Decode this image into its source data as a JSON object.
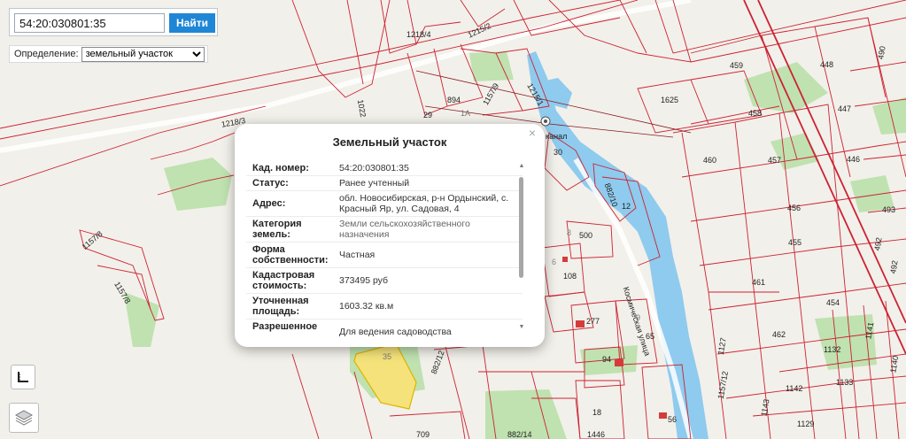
{
  "search": {
    "value": "54:20:030801:35",
    "button_label": "Найти"
  },
  "definition": {
    "label": "Определение:",
    "selected": "земельный участок"
  },
  "popup": {
    "title": "Земельный участок",
    "close_symbol": "×",
    "rows": [
      {
        "label": "Кад. номер:",
        "value": "54:20:030801:35"
      },
      {
        "label": "Статус:",
        "value": "Ранее учтенный"
      },
      {
        "label": "Адрес:",
        "value": "обл. Новосибирская, р-н Ордынский, с. Красный Яр, ул. Садовая, 4"
      },
      {
        "label": "Категория земель:",
        "value": "Земли сельскохозяйственного назначения"
      },
      {
        "label": "Форма собственности:",
        "value": "Частная"
      },
      {
        "label": "Кадастровая стоимость:",
        "value": "373495 руб"
      },
      {
        "label": "Уточненная площадь:",
        "value": "1603.32 кв.м"
      },
      {
        "label": "Разрешенное",
        "value": "Для ведения садоводства"
      }
    ]
  },
  "map": {
    "parcel_labels": [
      "1218/4",
      "1215/2",
      "1218/3",
      "1022",
      "1157/9",
      "1215/1",
      "894",
      "29",
      "1А",
      "1625",
      "459",
      "448",
      "490",
      "458",
      "447",
      "460",
      "457",
      "446",
      "456",
      "493",
      "455",
      "492",
      "492",
      "461",
      "454",
      "462",
      "1141",
      "1132",
      "1140",
      "1133",
      "1142",
      "1143",
      "1129",
      "30",
      "882/10",
      "12",
      "8",
      "500",
      "6",
      "108",
      "1157/8",
      "1157/8",
      "277",
      "9",
      "65",
      "94",
      "882/12",
      "1127",
      "1157/12",
      "18",
      "56",
      "709",
      "882/14",
      "1446",
      "35"
    ],
    "street_labels": [
      "Космическая улица",
      "канал"
    ],
    "colors": {
      "parcel_border": "#cc2233",
      "water": "#8ecbee",
      "vegetation": "#bfe2b0",
      "selected_parcel": "#f5e27a",
      "background": "#f2f0ea"
    }
  }
}
